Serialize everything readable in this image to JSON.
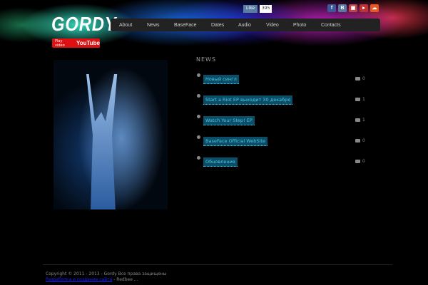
{
  "header": {
    "logo": "GORDY",
    "youtube": {
      "label": "Play video",
      "brand": "YouTube"
    },
    "vk": {
      "label": "Like",
      "count": "395"
    },
    "social": [
      {
        "name": "facebook",
        "glyph": "f",
        "color": "#3b5998"
      },
      {
        "name": "vkontakte",
        "glyph": "B",
        "color": "#5b7aa0"
      },
      {
        "name": "youtube",
        "glyph": "▣",
        "color": "#b44"
      },
      {
        "name": "play",
        "glyph": "▸",
        "color": "#b33"
      },
      {
        "name": "soundcloud",
        "glyph": "☁",
        "color": "#e65a1e"
      }
    ]
  },
  "nav": [
    "About",
    "News",
    "BaseFace",
    "Dates",
    "Audio",
    "Video",
    "Photo",
    "Contacts"
  ],
  "news": {
    "heading": "NEWS",
    "items": [
      {
        "title": "Новый сингл",
        "comments": "0"
      },
      {
        "title": "Start a Riot EP выходит 30 декабря",
        "comments": "1"
      },
      {
        "title": "Watch Your Step! EP",
        "comments": "1"
      },
      {
        "title": "BaseFace Official WebSite",
        "comments": "0"
      },
      {
        "title": "Обновления",
        "comments": "0"
      }
    ]
  },
  "footer": {
    "copyright": "Copyright © 2011 - 2013 - Gordy Все права защищены",
    "link": "Разработка и создание сайта",
    "suffix": " - Redbee ..."
  }
}
